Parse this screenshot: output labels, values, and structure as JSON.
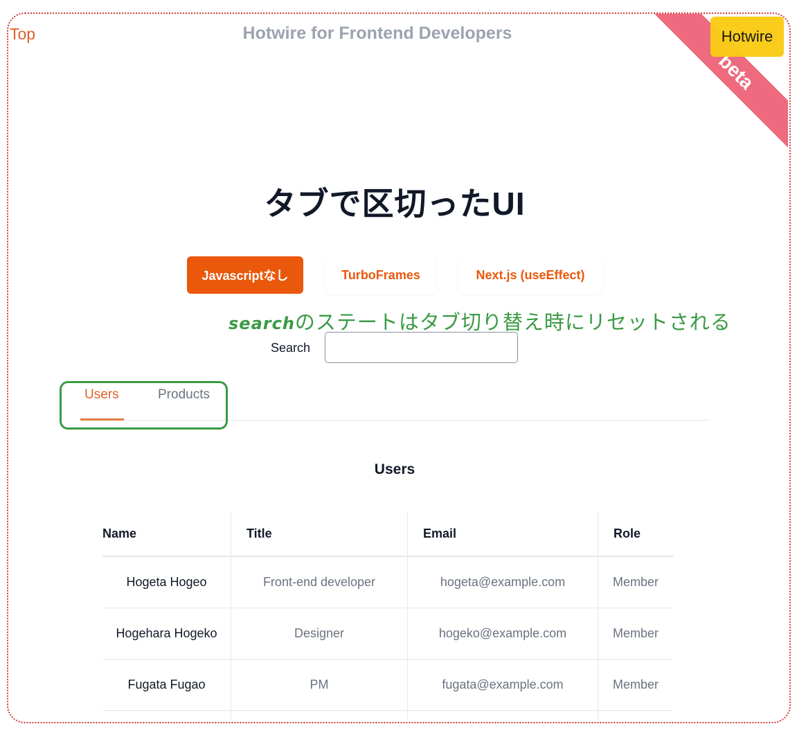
{
  "header": {
    "top_link": "Top",
    "site_title": "Hotwire for Frontend Developers",
    "ribbon_label": "beta",
    "hotwire_button": "Hotwire"
  },
  "colors": {
    "accent": "#ea580c",
    "ribbon": "#ee6a7f",
    "hotwire_button": "#facc15",
    "annotation": "#3a9a44",
    "frame_border": "#d03a3a"
  },
  "main": {
    "title": "タブで区切ったUI",
    "nav_buttons": [
      {
        "label": "Javascriptなし",
        "active": true
      },
      {
        "label": "TurboFrames",
        "active": false
      },
      {
        "label": "Next.js (useEffect)",
        "active": false
      }
    ],
    "annotation": {
      "latin": "search",
      "text": "のステートはタブ切り替え時にリセットされる"
    },
    "search": {
      "label": "Search",
      "value": "",
      "placeholder": ""
    },
    "tabs": [
      {
        "label": "Users",
        "active": true
      },
      {
        "label": "Products",
        "active": false
      }
    ],
    "section_heading": "Users"
  },
  "table": {
    "columns": [
      "Name",
      "Title",
      "Email",
      "Role"
    ],
    "rows": [
      {
        "name": "Hogeta Hogeo",
        "title": "Front-end developer",
        "email": "hogeta@example.com",
        "role": "Member"
      },
      {
        "name": "Hogehara Hogeko",
        "title": "Designer",
        "email": "hogeko@example.com",
        "role": "Member"
      },
      {
        "name": "Fugata Fugao",
        "title": "PM",
        "email": "fugata@example.com",
        "role": "Member"
      }
    ]
  }
}
